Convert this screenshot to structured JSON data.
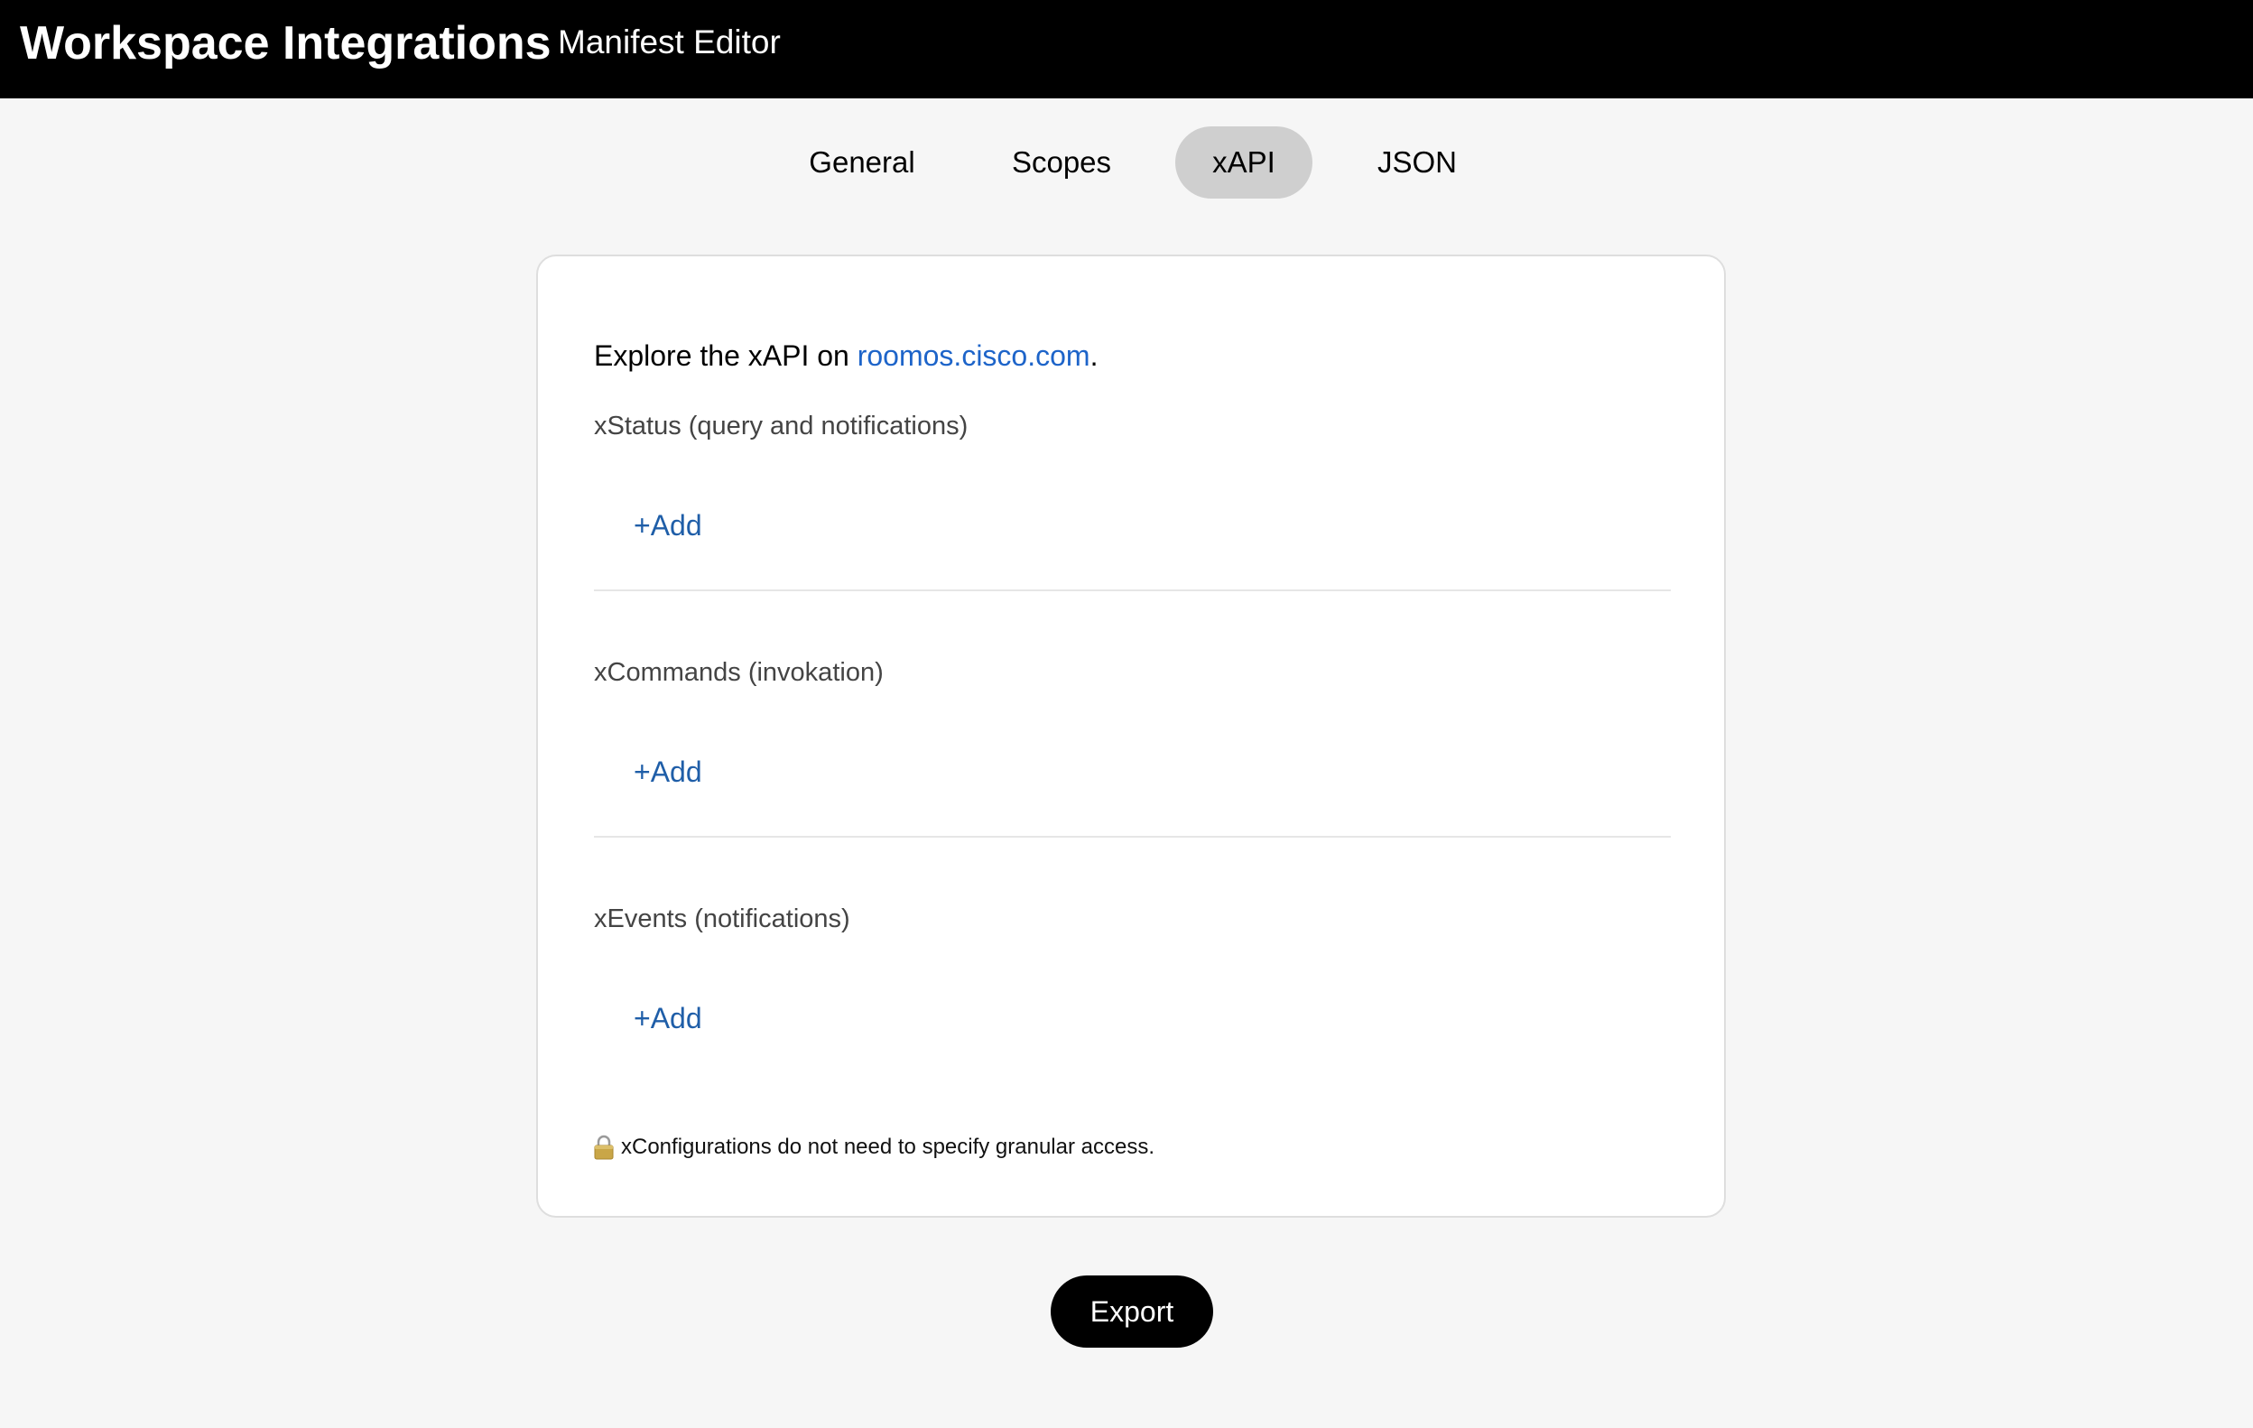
{
  "header": {
    "app_title": "Workspace Integrations",
    "subtitle": "Manifest Editor"
  },
  "tabs": [
    {
      "label": "General",
      "active": false
    },
    {
      "label": "Scopes",
      "active": false
    },
    {
      "label": "xAPI",
      "active": true
    },
    {
      "label": "JSON",
      "active": false
    }
  ],
  "card": {
    "intro_prefix": "Explore the xAPI on ",
    "intro_link": "roomos.cisco.com",
    "intro_suffix": ".",
    "sections": [
      {
        "label": "xStatus (query and notifications)",
        "add_label": "+Add"
      },
      {
        "label": "xCommands (invokation)",
        "add_label": "+Add"
      },
      {
        "label": "xEvents (notifications)",
        "add_label": "+Add"
      }
    ],
    "note_icon": "lock-icon",
    "note": "xConfigurations do not need to specify granular access."
  },
  "footer": {
    "export_label": "Export"
  },
  "colors": {
    "header_bg": "#000000",
    "page_bg": "#f6f6f6",
    "active_tab_bg": "#cfcfcf",
    "link": "#1d64c9",
    "add": "#1f5ea8"
  }
}
